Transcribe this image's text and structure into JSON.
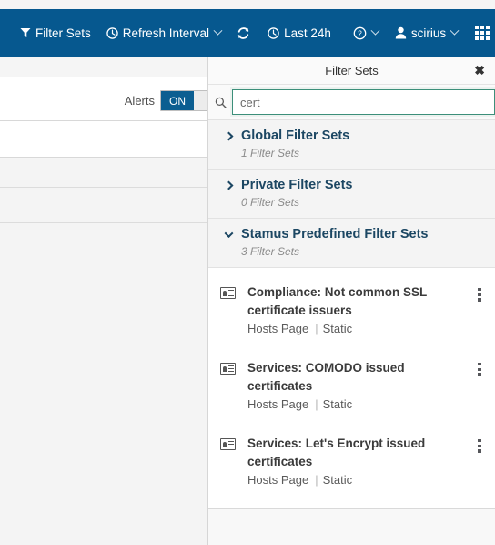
{
  "navbar": {
    "background": "#06588f",
    "items": [
      {
        "id": "filter-sets",
        "label": "Filter Sets",
        "icon": "filter-icon",
        "caret": false
      },
      {
        "id": "refresh-interval",
        "label": "Refresh Interval",
        "icon": "clock-icon",
        "caret": true
      },
      {
        "id": "refresh",
        "label": "",
        "icon": "refresh-icon",
        "caret": false
      },
      {
        "id": "time-range",
        "label": "Last 24h",
        "icon": "clock-icon",
        "caret": false
      },
      {
        "id": "help",
        "label": "",
        "icon": "question-circle-icon",
        "caret": true
      },
      {
        "id": "user",
        "label": "scirius",
        "icon": "user-icon",
        "caret": true
      },
      {
        "id": "app-launcher",
        "label": "",
        "icon": "grid-icon",
        "caret": false
      }
    ]
  },
  "page": {
    "alerts_label": "Alerts",
    "alerts_toggle_value": "ON",
    "alerts_toggle_color": "#0b5e91"
  },
  "drawer": {
    "title": "Filter Sets",
    "close_label": "✖",
    "search": {
      "value": "cert",
      "placeholder": "Search",
      "icon": "search-icon",
      "focus_border_color": "#3c8f7a"
    },
    "groups": [
      {
        "id": "global",
        "title": "Global Filter Sets",
        "subtitle": "1 Filter Sets",
        "expanded": false,
        "chevron": "chevron-right-icon"
      },
      {
        "id": "private",
        "title": "Private Filter Sets",
        "subtitle": "0 Filter Sets",
        "expanded": false,
        "chevron": "chevron-right-icon"
      },
      {
        "id": "stamus-predefined",
        "title": "Stamus Predefined Filter Sets",
        "subtitle": "3 Filter Sets",
        "expanded": true,
        "chevron": "chevron-down-icon"
      }
    ],
    "filter_sets": [
      {
        "name": "Compliance: Not common SSL certificate issuers",
        "page": "Hosts Page",
        "separator": "|",
        "type": "Static",
        "icon": "id-card-icon",
        "menu_icon": "kebab-menu-icon"
      },
      {
        "name": "Services: COMODO issued certificates",
        "page": "Hosts Page",
        "separator": "|",
        "type": "Static",
        "icon": "id-card-icon",
        "menu_icon": "kebab-menu-icon"
      },
      {
        "name": "Services: Let's Encrypt issued certificates",
        "page": "Hosts Page",
        "separator": "|",
        "type": "Static",
        "icon": "id-card-icon",
        "menu_icon": "kebab-menu-icon"
      }
    ]
  }
}
